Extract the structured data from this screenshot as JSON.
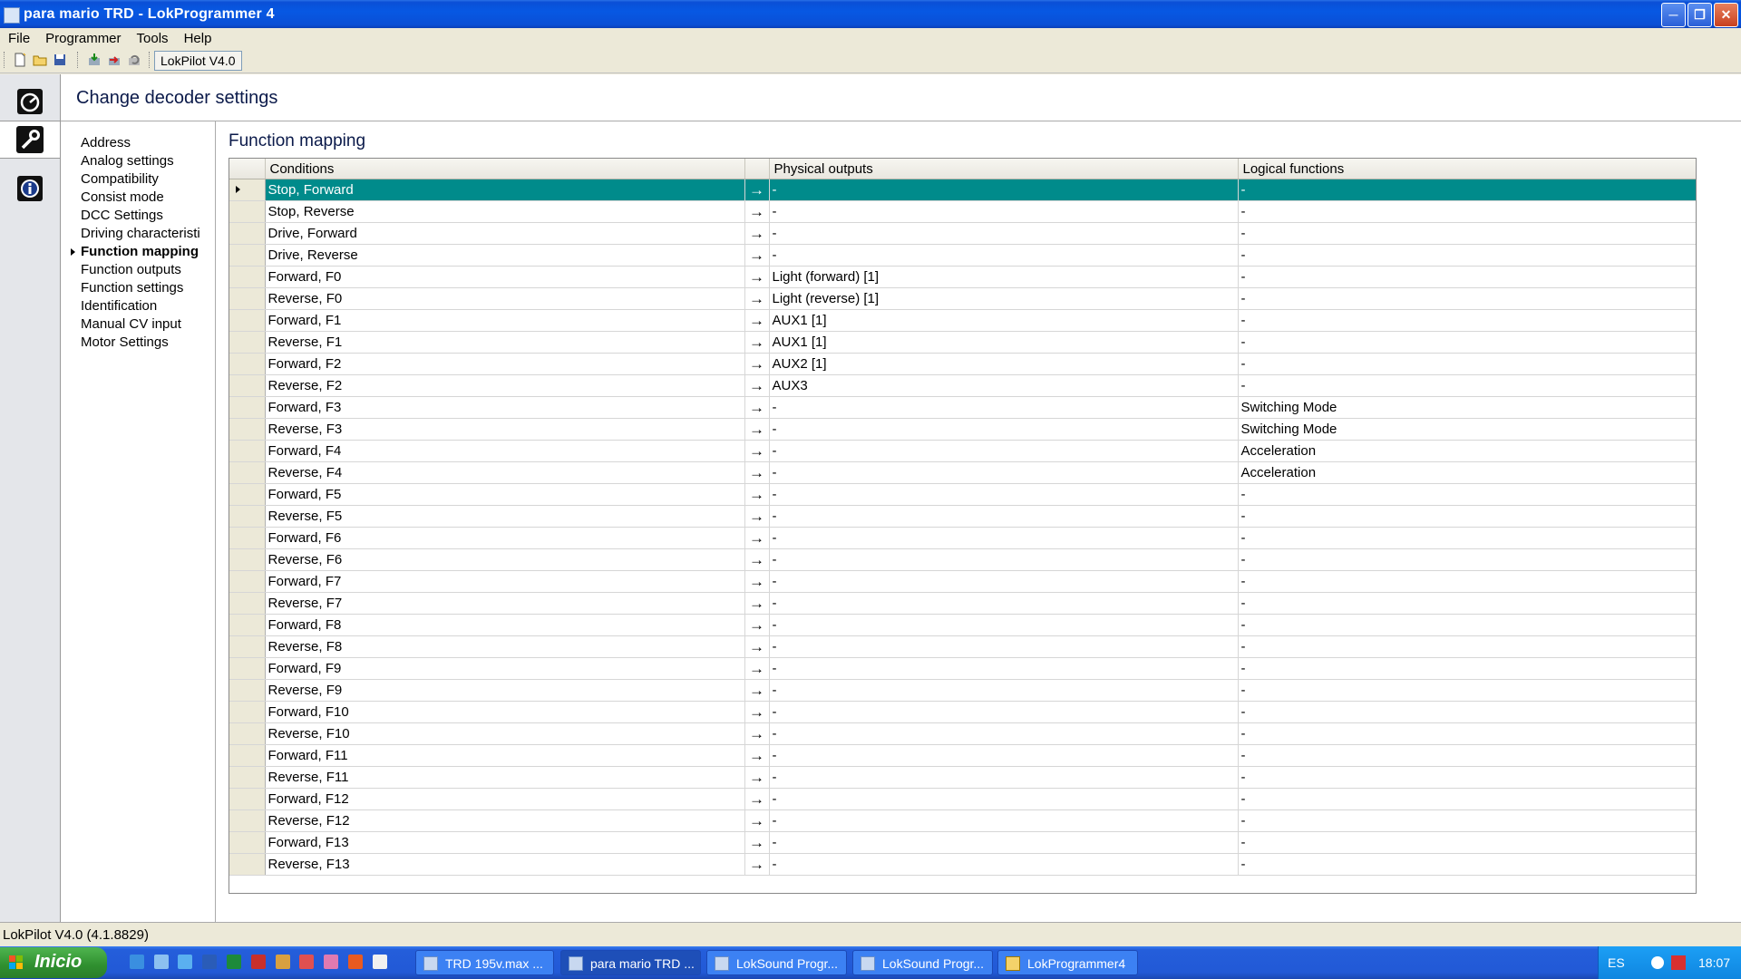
{
  "window": {
    "title": "para mario TRD - LokProgrammer 4"
  },
  "menu": [
    "File",
    "Programmer",
    "Tools",
    "Help"
  ],
  "toolbar": {
    "lokpilot_label": "LokPilot V4.0"
  },
  "header": {
    "title": "Change decoder settings"
  },
  "nav": {
    "items": [
      "Address",
      "Analog settings",
      "Compatibility",
      "Consist mode",
      "DCC Settings",
      "Driving characteristi",
      "Function mapping",
      "Function outputs",
      "Function settings",
      "Identification",
      "Manual CV input",
      "Motor Settings"
    ],
    "selected_index": 6
  },
  "section": {
    "title": "Function mapping"
  },
  "table": {
    "columns": [
      "Conditions",
      "Physical outputs",
      "Logical functions"
    ],
    "selected_row": 0,
    "rows": [
      [
        "Stop, Forward",
        "-",
        "-"
      ],
      [
        "Stop, Reverse",
        "-",
        "-"
      ],
      [
        "Drive, Forward",
        "-",
        "-"
      ],
      [
        "Drive, Reverse",
        "-",
        "-"
      ],
      [
        "Forward, F0",
        "Light (forward) [1]",
        "-"
      ],
      [
        "Reverse, F0",
        "Light (reverse) [1]",
        "-"
      ],
      [
        "Forward, F1",
        "AUX1 [1]",
        "-"
      ],
      [
        "Reverse, F1",
        "AUX1 [1]",
        "-"
      ],
      [
        "Forward, F2",
        "AUX2 [1]",
        "-"
      ],
      [
        "Reverse, F2",
        "AUX3",
        "-"
      ],
      [
        "Forward, F3",
        "-",
        "Switching Mode"
      ],
      [
        "Reverse, F3",
        "-",
        "Switching Mode"
      ],
      [
        "Forward, F4",
        "-",
        "Acceleration"
      ],
      [
        "Reverse, F4",
        "-",
        "Acceleration"
      ],
      [
        "Forward, F5",
        "-",
        "-"
      ],
      [
        "Reverse, F5",
        "-",
        "-"
      ],
      [
        "Forward, F6",
        "-",
        "-"
      ],
      [
        "Reverse, F6",
        "-",
        "-"
      ],
      [
        "Forward, F7",
        "-",
        "-"
      ],
      [
        "Reverse, F7",
        "-",
        "-"
      ],
      [
        "Forward, F8",
        "-",
        "-"
      ],
      [
        "Reverse, F8",
        "-",
        "-"
      ],
      [
        "Forward, F9",
        "-",
        "-"
      ],
      [
        "Reverse, F9",
        "-",
        "-"
      ],
      [
        "Forward, F10",
        "-",
        "-"
      ],
      [
        "Reverse, F10",
        "-",
        "-"
      ],
      [
        "Forward, F11",
        "-",
        "-"
      ],
      [
        "Reverse, F11",
        "-",
        "-"
      ],
      [
        "Forward, F12",
        "-",
        "-"
      ],
      [
        "Reverse, F12",
        "-",
        "-"
      ],
      [
        "Forward, F13",
        "-",
        "-"
      ],
      [
        "Reverse, F13",
        "-",
        "-"
      ]
    ]
  },
  "status": {
    "text": "LokPilot V4.0 (4.1.8829)"
  },
  "taskbar": {
    "start_label": "Inicio",
    "tasks": [
      "TRD 195v.max ...",
      "para mario TRD ...",
      "LokSound Progr...",
      "LokSound Progr...",
      "LokProgrammer4"
    ],
    "active_task": 1,
    "language": "ES",
    "clock": "18:07"
  },
  "colors": {
    "selection": "#008b8b",
    "titlebar": "#0a4fd6",
    "taskbar": "#245edb",
    "start": "#2f8f2f"
  }
}
